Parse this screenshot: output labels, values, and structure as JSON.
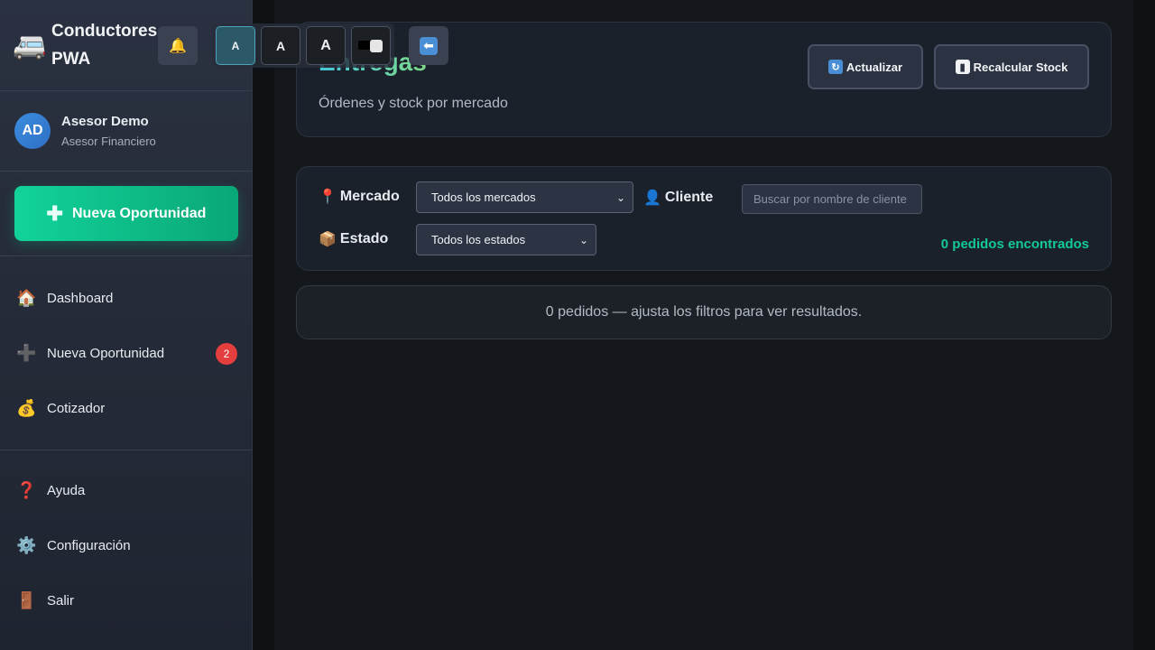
{
  "app": {
    "title": "Conductores PWA",
    "logo_icon": "🚐"
  },
  "user": {
    "initials": "AD",
    "name": "Asesor Demo",
    "role": "Asesor Financiero"
  },
  "sidebar": {
    "cta_label": "Nueva Oportunidad",
    "items": [
      {
        "label": "Dashboard",
        "icon": "🏠"
      },
      {
        "label": "Nueva Oportunidad",
        "icon": "➕",
        "badge": "2"
      },
      {
        "label": "Cotizador",
        "icon": "💰"
      }
    ],
    "bottom_items": [
      {
        "label": "Ayuda",
        "icon": "❓"
      },
      {
        "label": "Configuración",
        "icon": "⚙️"
      },
      {
        "label": "Salir",
        "icon": "🚪"
      }
    ]
  },
  "toolbar": {
    "bell_icon": "🔔",
    "font_small": "A",
    "font_medium": "A",
    "font_large": "A",
    "back_icon": "⬅"
  },
  "page": {
    "title": "Entregas",
    "subtitle": "Órdenes y stock por mercado",
    "refresh_label": "Actualizar",
    "refresh_icon": "🔄",
    "stock_label": "Recalcular Stock",
    "stock_icon": "📊"
  },
  "filters": {
    "market_label": "Mercado",
    "market_icon": "📍",
    "market_value": "Todos los mercados",
    "client_label": "Cliente",
    "client_icon": "👤",
    "client_placeholder": "Buscar por nombre de cliente",
    "status_label": "Estado",
    "status_icon": "📦",
    "status_value": "Todos los estados",
    "count_text": "0 pedidos encontrados"
  },
  "results": {
    "empty_text": "0 pedidos — ajusta los filtros para ver resultados."
  },
  "colors": {
    "accent_green": "#14c995",
    "badge_red": "#e53e3e",
    "title_gradient_start": "#46c7d8",
    "title_gradient_end": "#7ed98a"
  }
}
